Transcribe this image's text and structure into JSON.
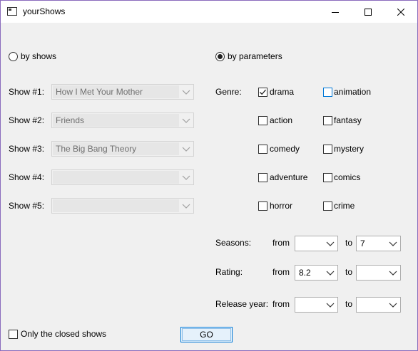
{
  "window": {
    "title": "yourShows",
    "icons": {
      "app": "app-window-icon",
      "minimize": "minimize-icon",
      "maximize": "maximize-icon",
      "close": "close-icon"
    }
  },
  "mode": {
    "by_shows_label": "by shows",
    "by_parameters_label": "by parameters",
    "selected": "by parameters"
  },
  "shows": [
    {
      "label": "Show #1:",
      "value": "How I Met Your Mother"
    },
    {
      "label": "Show #2:",
      "value": "Friends"
    },
    {
      "label": "Show #3:",
      "value": "The Big Bang Theory"
    },
    {
      "label": "Show #4:",
      "value": ""
    },
    {
      "label": "Show #5:",
      "value": ""
    }
  ],
  "genre": {
    "label": "Genre:",
    "items": [
      {
        "label": "drama",
        "checked": true
      },
      {
        "label": "animation",
        "checked": false
      },
      {
        "label": "action",
        "checked": false
      },
      {
        "label": "fantasy",
        "checked": false
      },
      {
        "label": "comedy",
        "checked": false
      },
      {
        "label": "mystery",
        "checked": false
      },
      {
        "label": "adventure",
        "checked": false
      },
      {
        "label": "comics",
        "checked": false
      },
      {
        "label": "horror",
        "checked": false
      },
      {
        "label": "crime",
        "checked": false
      }
    ]
  },
  "seasons": {
    "label": "Seasons:",
    "from_label": "from",
    "to_label": "to",
    "from": "",
    "to": "7"
  },
  "rating": {
    "label": "Rating:",
    "from_label": "from",
    "to_label": "to",
    "from": "8.2",
    "to": ""
  },
  "release_year": {
    "label": "Release year:",
    "from_label": "from",
    "to_label": "to",
    "from": "",
    "to": ""
  },
  "closed_only": {
    "label": "Only the closed shows",
    "checked": false
  },
  "go_label": "GO",
  "colors": {
    "focus_blue": "#0078d7",
    "window_bg": "#f0f0f0",
    "border_accent": "#8a6bbd"
  }
}
